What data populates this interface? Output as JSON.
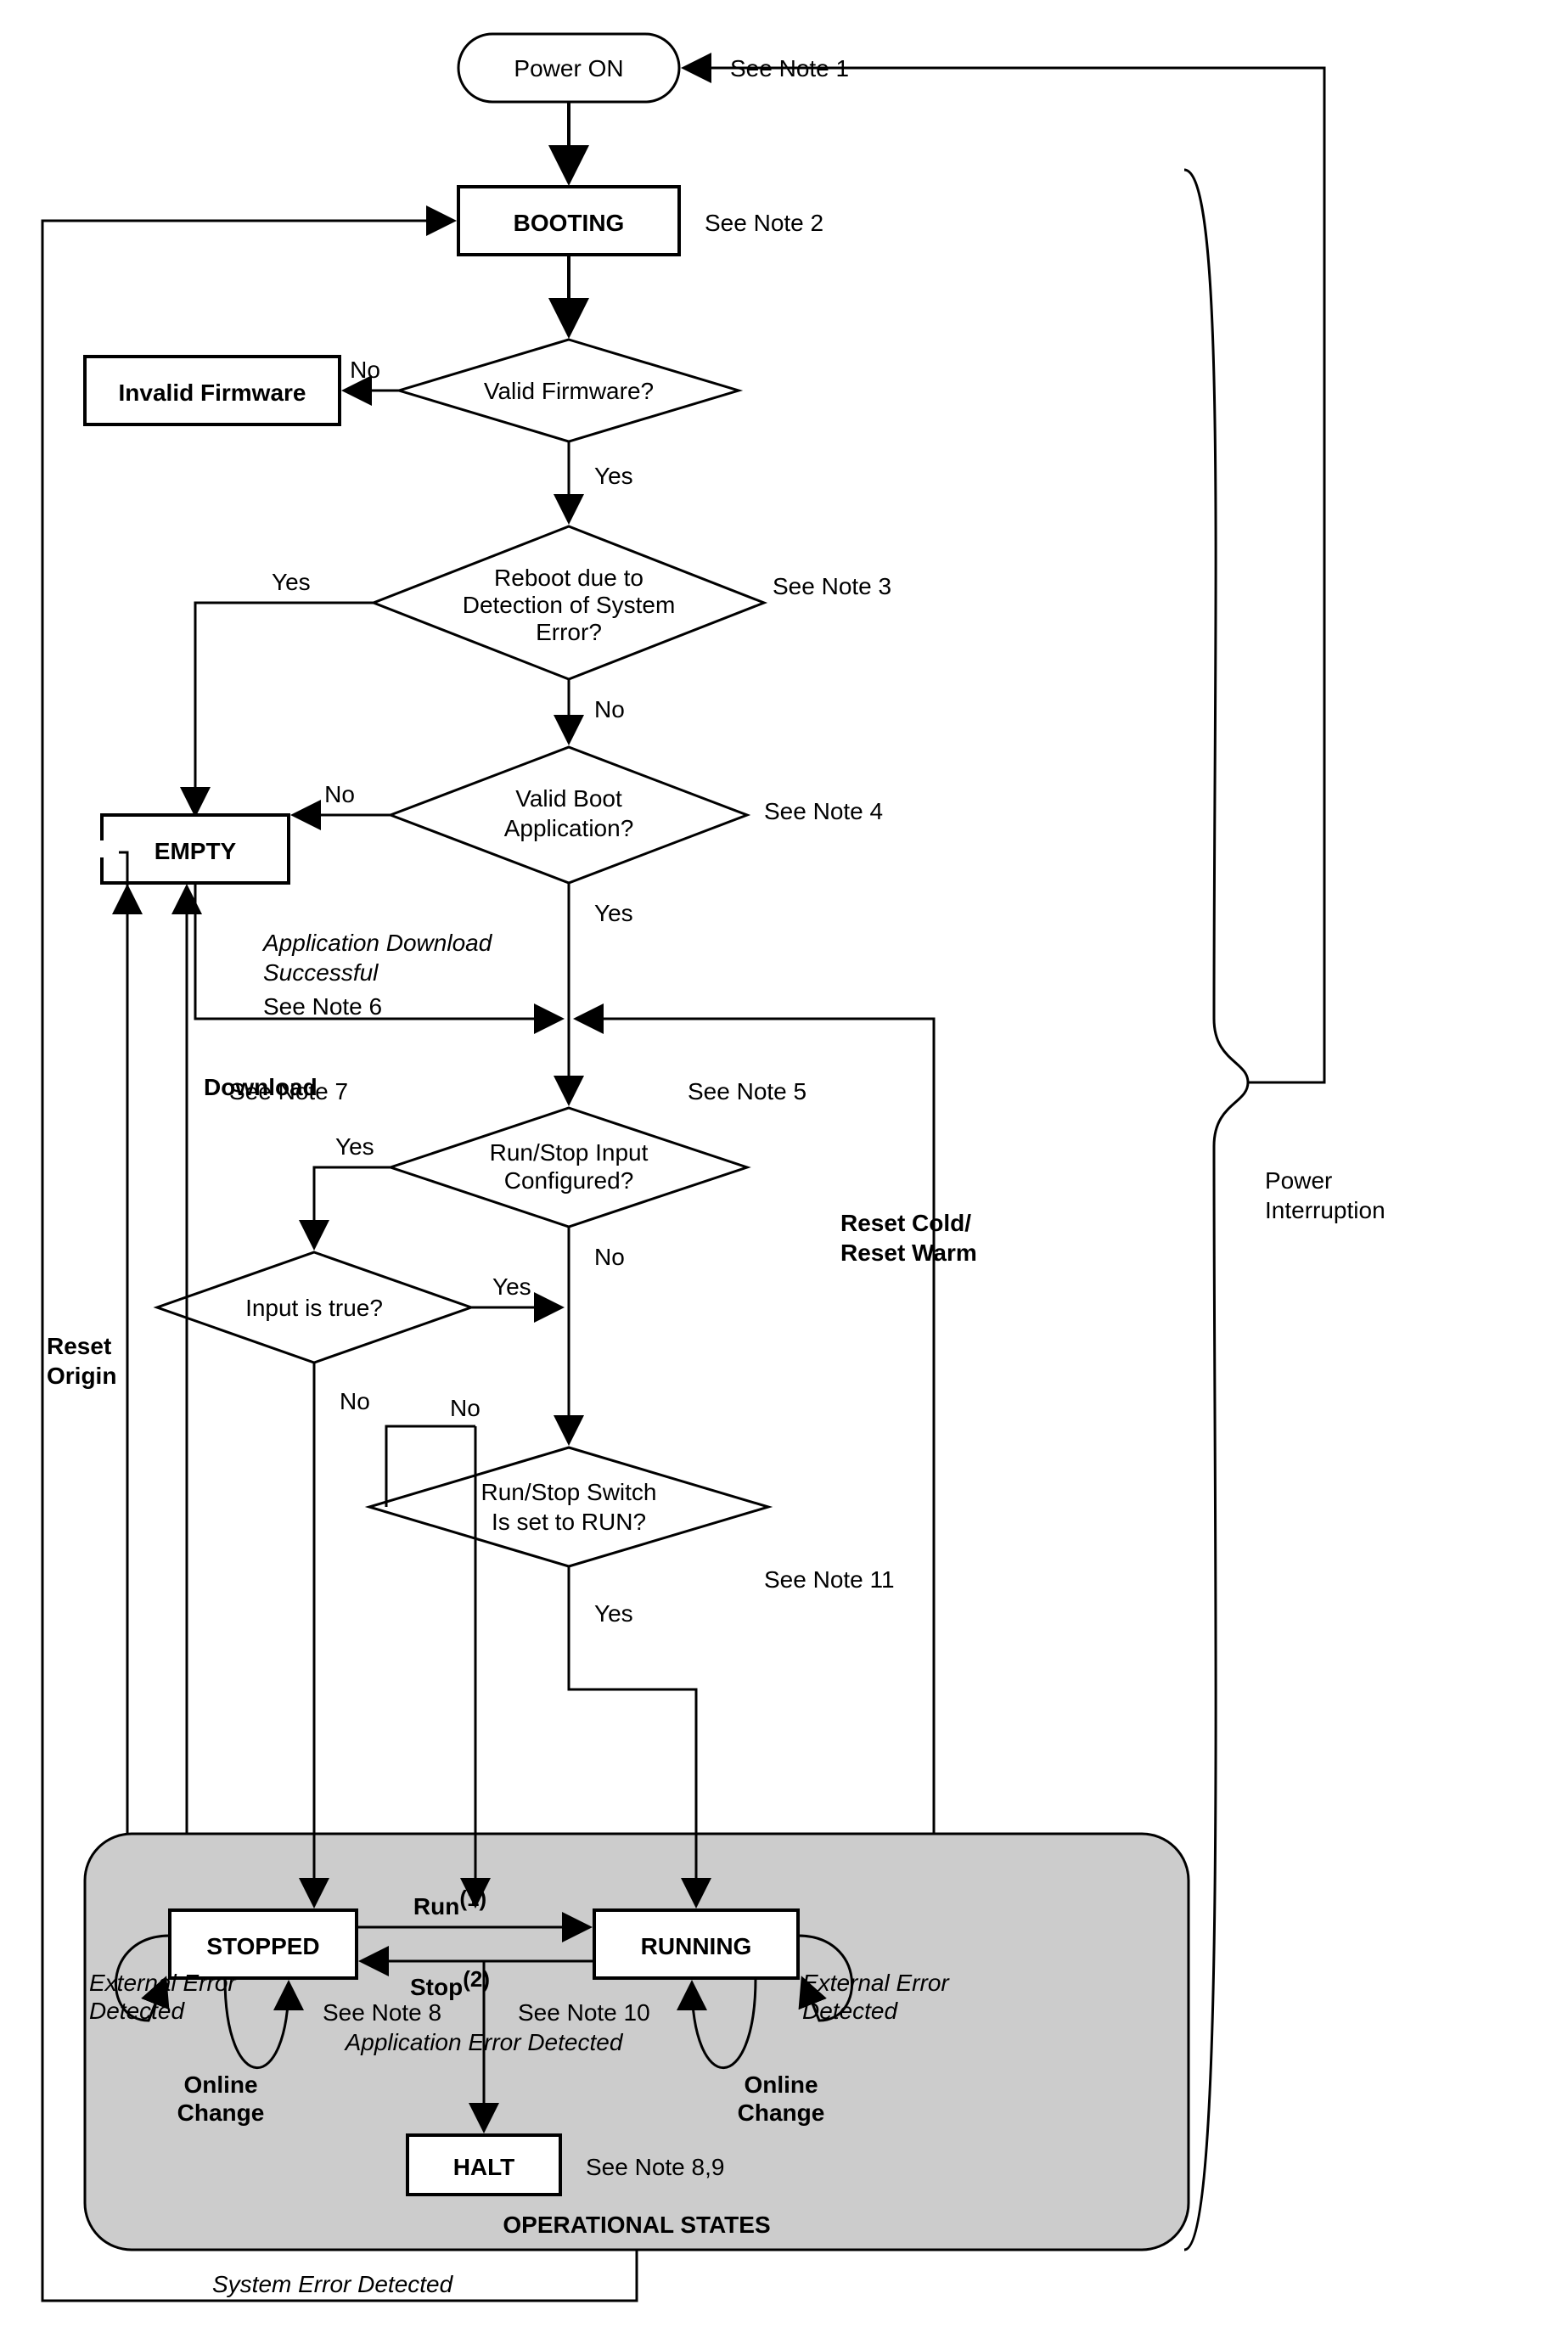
{
  "nodes": {
    "power_on": "Power ON",
    "booting": "BOOTING",
    "invalid_firmware": "Invalid Firmware",
    "valid_firmware": "Valid Firmware?",
    "reboot_sys_error_l1": "Reboot due to",
    "reboot_sys_error_l2": "Detection of System",
    "reboot_sys_error_l3": "Error?",
    "empty": "EMPTY",
    "valid_boot_app_l1": "Valid Boot",
    "valid_boot_app_l2": "Application?",
    "run_stop_cfg_l1": "Run/Stop Input",
    "run_stop_cfg_l2": "Configured?",
    "input_true": "Input is true?",
    "run_stop_switch_l1": "Run/Stop Switch",
    "run_stop_switch_l2": "Is set to RUN?",
    "stopped": "STOPPED",
    "running": "RUNNING",
    "halt": "HALT",
    "operational_states": "OPERATIONAL STATES"
  },
  "edge": {
    "yes": "Yes",
    "no": "No",
    "run": "Run",
    "run_sup": "(1)",
    "stop": "Stop",
    "stop_sup": "(2)",
    "download": "Download",
    "reset_origin": "Reset",
    "reset_origin2": "Origin",
    "reset_cold_l1": "Reset Cold/",
    "reset_cold_l2": "Reset Warm",
    "online_change_l1": "Online",
    "online_change_l2": "Change",
    "ext_err_l1": "External Error",
    "ext_err_l2": "Detected",
    "app_download_l1": "Application Download",
    "app_download_l2": "Successful",
    "app_err": "Application Error Detected",
    "sys_err": "System Error Detected",
    "power_interruption_l1": "Power",
    "power_interruption_l2": "Interruption"
  },
  "notes": {
    "n1": "See Note 1",
    "n2": "See Note 2",
    "n3": "See Note 3",
    "n4": "See Note 4",
    "n5": "See Note 5",
    "n6": "See Note 6",
    "n7": "See Note 7",
    "n8": "See Note 8",
    "n10": "See Note 10",
    "n89": "See Note 8,9",
    "n11": "See Note 11"
  }
}
